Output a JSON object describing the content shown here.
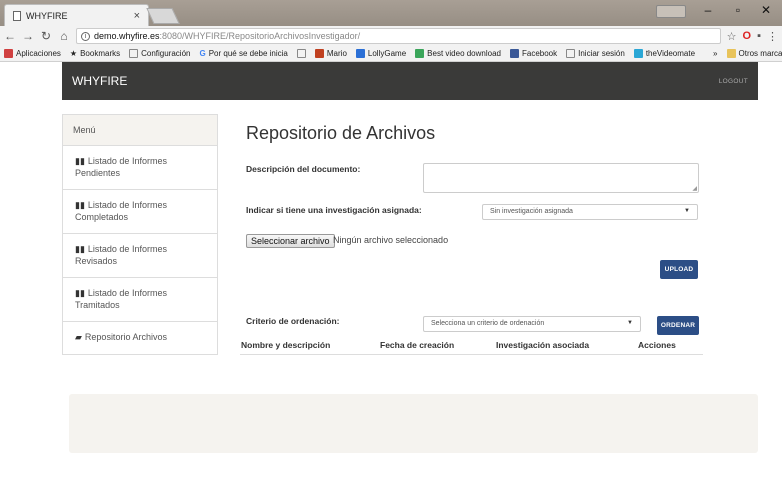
{
  "browser": {
    "tab_title": "WHYFIRE",
    "url_host": "demo.whyfire.es",
    "url_path": ":8080/WHYFIRE/RepositorioArchivosInvestigador/",
    "bookmarks": [
      {
        "label": "Aplicaciones",
        "color": "#d04040"
      },
      {
        "label": "Bookmarks",
        "color": "#444444"
      },
      {
        "label": "Configuración",
        "color": "#888888"
      },
      {
        "label": "Por qué se debe inicia",
        "color": "#4285f4"
      },
      {
        "label": "",
        "color": "#888888"
      },
      {
        "label": "Mario",
        "color": "#c04020"
      },
      {
        "label": "LollyGame",
        "color": "#2a6fd6"
      },
      {
        "label": "Best video download",
        "color": "#3aa55a"
      },
      {
        "label": "Facebook",
        "color": "#3b5998"
      },
      {
        "label": "Iniciar sesión",
        "color": "#888888"
      },
      {
        "label": "theVideomate",
        "color": "#2aa7d6"
      }
    ],
    "bookmarks_more": "»",
    "other_bookmarks": "Otros marcadores"
  },
  "navbar": {
    "brand": "WHYFIRE",
    "logout": "LOGOUT"
  },
  "sidebar": {
    "header": "Menú",
    "items": [
      {
        "label": "Listado de Informes Pendientes"
      },
      {
        "label": "Listado de Informes Completados"
      },
      {
        "label": "Listado de Informes Revisados"
      },
      {
        "label": "Listado de Informes Tramitados"
      },
      {
        "label": "Repositorio Archivos"
      }
    ]
  },
  "main": {
    "title": "Repositorio de Archivos",
    "description_label": "Descripción del documento:",
    "investigation_label": "Indicar si tiene una investigación asignada:",
    "investigation_value": "Sin investigación asignada",
    "file_button": "Seleccionar archivo",
    "file_status": "Ningún archivo seleccionado",
    "upload_button": "UPLOAD",
    "sort_label": "Criterio de ordenación:",
    "sort_placeholder": "Selecciona un criterio de ordenación",
    "sort_button": "ORDENAR",
    "table_headers": [
      "Nombre y descripción",
      "Fecha de creación",
      "Investigación asociada",
      "Acciones"
    ]
  }
}
